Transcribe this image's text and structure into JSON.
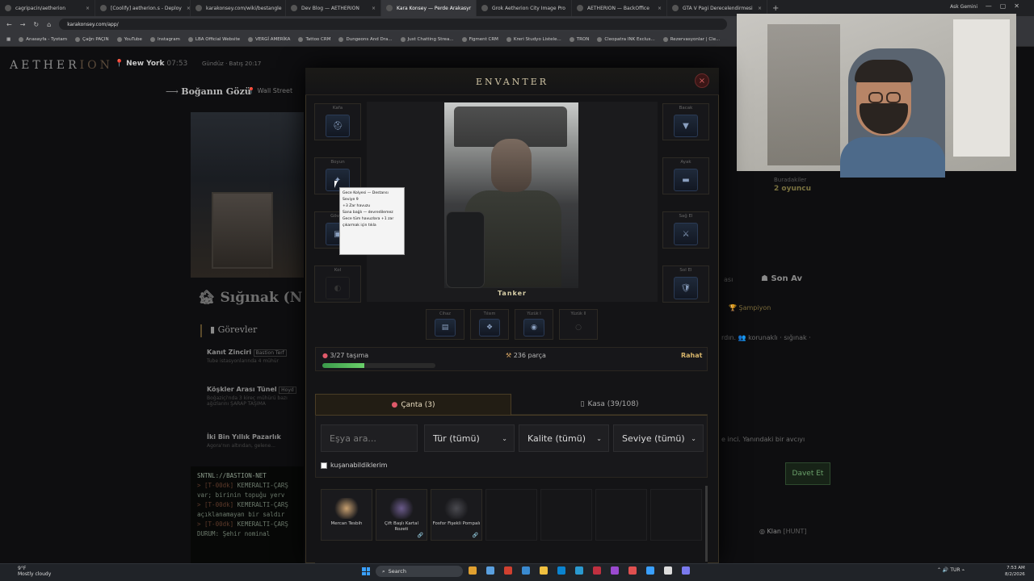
{
  "browser": {
    "tabs": [
      {
        "label": "cagripacin/aetherion",
        "active": false
      },
      {
        "label": "[Coolify] aetherion.s - Deploy",
        "active": false
      },
      {
        "label": "karakonsey.com/wiki/bestangle",
        "active": false
      },
      {
        "label": "Dev Blog — AETHERION",
        "active": false
      },
      {
        "label": "Kara Konsey — Perde Arakasyr",
        "active": true
      },
      {
        "label": "Grok Aetherion City Image Pro",
        "active": false
      },
      {
        "label": "AETHERION — BackOffice",
        "active": false
      },
      {
        "label": "GTA V Pagi Derecelendirmesi",
        "active": false
      }
    ],
    "new_tab": "+",
    "profile": "Ask Gemini",
    "url": "karakonsey.com/app/",
    "bookmarks": [
      "Anasayfa - Tyotam",
      "Çağrı PAÇIN",
      "YouTube",
      "Instagram",
      "LBA Official Website",
      "VERGİ AMERİKA",
      "Tattoo CRM",
      "Dungeons And Dra...",
      "Just Chatting Strea...",
      "Figment CRM",
      "Kreri Studyo Listele...",
      "TRON",
      "Cleopatra INK Exclus...",
      "Rezervasyonlar | Cle..."
    ]
  },
  "game": {
    "logo_a": "AETHER",
    "logo_b": "ION",
    "city": "New York",
    "city_time": "07:53",
    "daytime": "Gündüz · Batış 20:17",
    "back_label": "Boğanın Gözü",
    "location": "Wall Street",
    "room_title": "Sığınak (N",
    "quests_title": "Görevler",
    "quests": [
      {
        "title": "Kanıt Zinciri",
        "tag": "Bastion Terf",
        "desc": "Tube istasyonlarında 4 mühür"
      },
      {
        "title": "Köşkler Arası Tünel",
        "tag": "Hoyd",
        "desc": "Boğaziçi'nda 3 kireç mühürü bazı ağızlarını ŞARAP TAŞIMA"
      },
      {
        "title": "İki Bin Yıllık Pazarlık",
        "tag": "",
        "desc": "Agora'nın altından, gelene..."
      }
    ],
    "terminal": {
      "header": "SNTNL://BASTION-NET",
      "lines": [
        {
          "prefix": "> [T-00dk]",
          "text": "KEMERALTI-ÇARŞ"
        },
        {
          "prefix": "",
          "text": "var; birinin topuğu yerv"
        },
        {
          "prefix": "> [T-00dk]",
          "text": "KEMERALTI-ÇARŞ"
        },
        {
          "prefix": "",
          "text": "açıklanamayan bir saldır"
        },
        {
          "prefix": "> [T-00dk]",
          "text": "KEMERALTI-ÇARŞ"
        },
        {
          "prefix": "",
          "text": "DURUM: Şehir nominal"
        }
      ]
    },
    "right": {
      "clan_label": "Buradakiler",
      "clan_value": "2 oyuncu",
      "last_hunt": "Son Av",
      "last_hunt_prefix": "ası",
      "champion": "Şampiyon",
      "hint": "rdın. 👥 korunaklı · sığınak ·",
      "invite_msg": "e inci. Yanındaki bir avcıyı",
      "invite_button": "Davet Et",
      "clan": "Klan",
      "clan_tag": "[HUNT]"
    }
  },
  "inventory": {
    "title": "ENVANTER",
    "close": "×",
    "character_name": "Tanker",
    "left_slots": [
      {
        "label": "Kafa",
        "icon": "helmet-icon",
        "glyph": "⛑",
        "filled": true
      },
      {
        "label": "Boyun",
        "icon": "amulet-icon",
        "glyph": "✦",
        "filled": true
      },
      {
        "label": "Gövde",
        "icon": "armor-icon",
        "glyph": "▣",
        "filled": true
      },
      {
        "label": "Kol",
        "icon": "arm-icon",
        "glyph": "◐",
        "filled": false
      }
    ],
    "right_slots": [
      {
        "label": "Bacak",
        "icon": "legs-icon",
        "glyph": "▼",
        "filled": true
      },
      {
        "label": "Ayak",
        "icon": "boots-icon",
        "glyph": "▬",
        "filled": true
      },
      {
        "label": "Sağ El",
        "icon": "weapon-right-icon",
        "glyph": "⚔",
        "filled": true
      },
      {
        "label": "Sol El",
        "icon": "weapon-left-icon",
        "glyph": "🛡",
        "filled": true
      }
    ],
    "accessory_slots": [
      {
        "label": "Cihaz",
        "icon": "device-icon",
        "glyph": "▤",
        "filled": true
      },
      {
        "label": "Tılsım",
        "icon": "talisman-icon",
        "glyph": "❖",
        "filled": true
      },
      {
        "label": "Yüzük I",
        "icon": "ring-icon",
        "glyph": "◉",
        "filled": true
      },
      {
        "label": "Yüzük II",
        "icon": "ring-empty-icon",
        "glyph": "○",
        "filled": false
      }
    ],
    "tooltip": {
      "lines": [
        "Gece Kolyesi — Destansı",
        "Seviye 9",
        "",
        "+3 Zar havuzu",
        "",
        "Sana bağlı — devredilemez",
        "",
        "Gece tüm havuzlara +1 zar",
        "",
        "çıkarmak için tıkla"
      ]
    },
    "carry": "3/27 taşıma",
    "carry_fraction": 0.37,
    "parts": "236 parça",
    "status": "Rahat",
    "tabs": {
      "bag": "Çanta (3)",
      "safe": "Kasa (39/108)"
    },
    "filters": {
      "search_placeholder": "Eşya ara...",
      "type": "Tür (tümü)",
      "quality": "Kalite (tümü)",
      "level": "Seviye (tümü)",
      "equippable": "kuşanabildiklerim"
    },
    "items": [
      {
        "name": "Mercan Tesbih",
        "color": "#c8a070",
        "bound": false
      },
      {
        "name": "Çift Başlı Kartal Rozeti",
        "color": "#6a5a8a",
        "bound": true
      },
      {
        "name": "Fosfor Fişekli Pompalı",
        "color": "#4a4a50",
        "bound": true
      }
    ],
    "empty_slots": 4
  },
  "taskbar": {
    "weather_temp": "9°F",
    "weather_desc": "Mostly cloudy",
    "search": "Search",
    "lang": "TUR",
    "time": "7:53 AM",
    "date": "8/2/2026"
  }
}
